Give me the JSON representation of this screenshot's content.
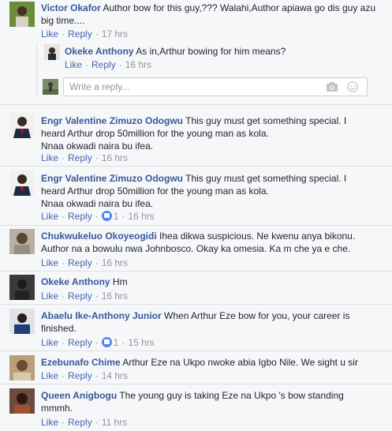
{
  "reply_input": {
    "placeholder": "Write a reply..."
  },
  "actions": {
    "like": "Like",
    "reply": "Reply"
  },
  "comments": [
    {
      "author": "Victor Okafor",
      "text": "Author bow for this guy,??? Walahi,Author apiawa go dis guy azu big time....",
      "time": "17 hrs",
      "reactions": null
    },
    {
      "author": "Okeke Anthony",
      "text": "As in,Arthur bowing for him means?",
      "time": "16 hrs",
      "reactions": null
    },
    {
      "author": "Engr Valentine Zimuzo Odogwu",
      "text": "This guy must get something special. I heard Arthur drop 50million for the young man as kola.",
      "text2": "Nnaa okwadi naira bu ifea.",
      "time": "16 hrs",
      "reactions": null
    },
    {
      "author": "Engr Valentine Zimuzo Odogwu",
      "text": "This guy must get something special. I heard Arthur drop 50million for the young man as kola.",
      "text2": "Nnaa okwadi naira bu ifea.",
      "time": "16 hrs",
      "reactions": "1"
    },
    {
      "author": "Chukwukeluo Okoyeogidi",
      "text": "Ihea dikwa suspicious. Ne kwenu anya bikonu. Author na a bowulu nwa Johnbosco. Okay ka omesia. Ka m che ya e che.",
      "time": "16 hrs",
      "reactions": null
    },
    {
      "author": "Okeke Anthony",
      "text": "Hm",
      "time": "16 hrs",
      "reactions": null
    },
    {
      "author": "Abaelu Ike-Anthony Junior",
      "text": "When Arthur Eze bow for you, your career is finished.",
      "time": "15 hrs",
      "reactions": "1"
    },
    {
      "author": "Ezebunafo Chime",
      "text": "Arthur Eze na Ukpo nwoke abia Igbo Nile. We sight u sir",
      "time": "14 hrs",
      "reactions": null
    },
    {
      "author": "Queen Anigbogu",
      "text": "The young guy is taking Eze na Ukpo 's bow standing mmmh.",
      "time": "11 hrs",
      "reactions": null
    }
  ]
}
